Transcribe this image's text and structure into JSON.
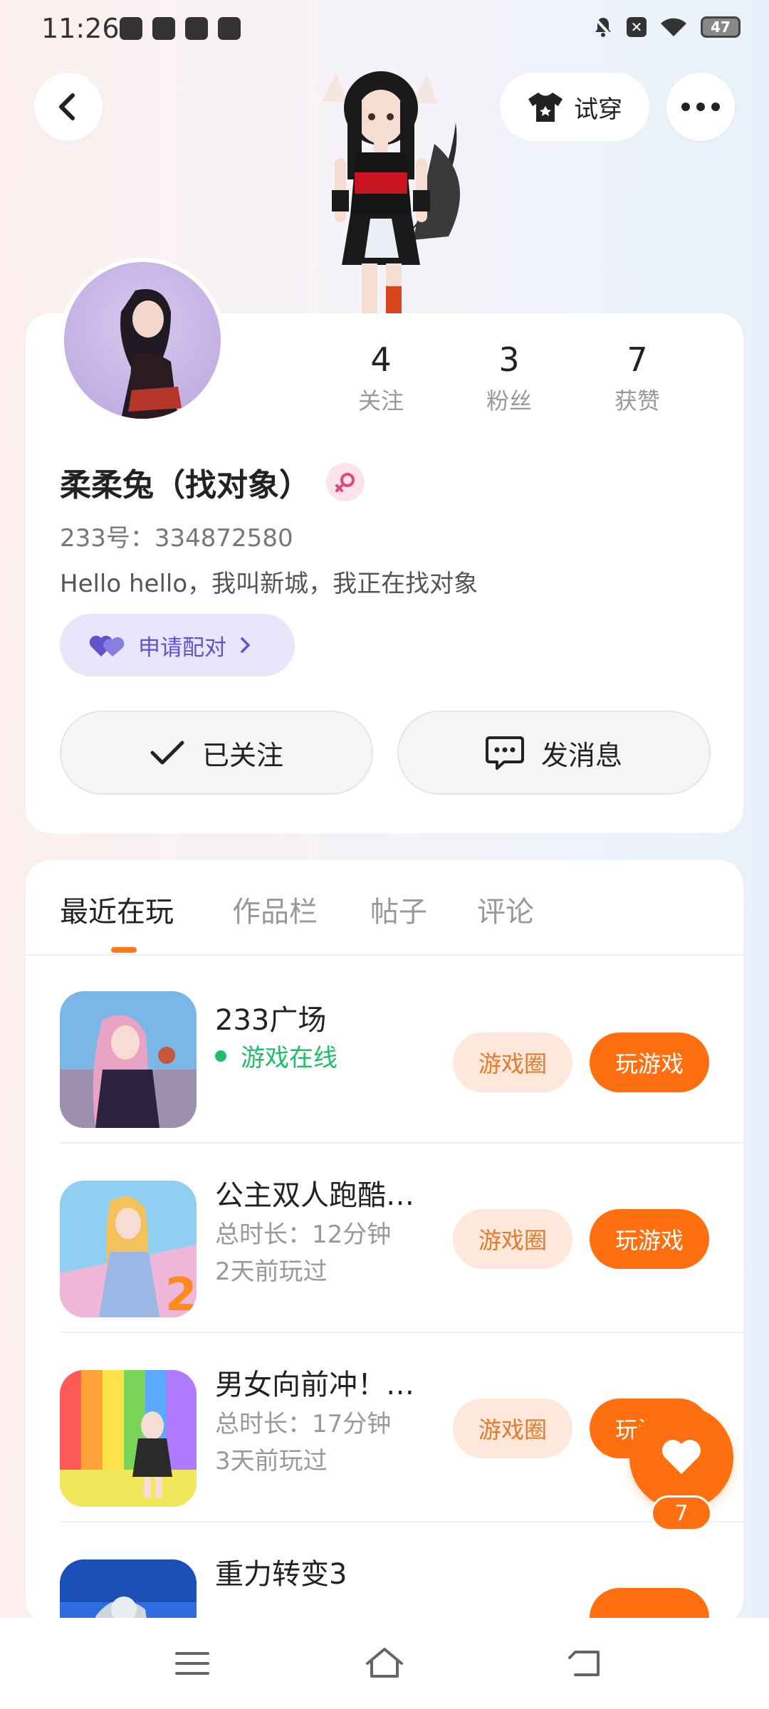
{
  "status_bar": {
    "time": "11:26",
    "battery": "47"
  },
  "header": {
    "tryon_label": "试穿"
  },
  "profile": {
    "stats": [
      {
        "value": "4",
        "label": "关注"
      },
      {
        "value": "3",
        "label": "粉丝"
      },
      {
        "value": "7",
        "label": "获赞"
      }
    ],
    "username": "柔柔兔（找对象）",
    "gender": "female",
    "uid": "233号：334872580",
    "bio": "Hello hello，我叫新城，我正在找对象",
    "pair_label": "申请配对",
    "followed_label": "已关注",
    "message_label": "发消息"
  },
  "tabs": [
    {
      "label": "最近在玩",
      "active": true
    },
    {
      "label": "作品栏",
      "active": false
    },
    {
      "label": "帖子",
      "active": false
    },
    {
      "label": "评论",
      "active": false
    }
  ],
  "games": [
    {
      "name": "233广场",
      "status": "游戏在线",
      "circle_label": "游戏圈",
      "play_label": "玩游戏"
    },
    {
      "name": "公主双人跑酷…",
      "duration": "总时长：12分钟",
      "last_played": "2天前玩过",
      "circle_label": "游戏圈",
      "play_label": "玩游戏"
    },
    {
      "name": "男女向前冲！…",
      "duration": "总时长：17分钟",
      "last_played": "3天前玩过",
      "circle_label": "游戏圈",
      "play_label": "玩游戏"
    },
    {
      "name": "重力转变3"
    }
  ],
  "like_fab": {
    "count": "7"
  },
  "colors": {
    "accent": "#ff6f0f",
    "online": "#1fbf6a",
    "pair": "#6353c9"
  }
}
